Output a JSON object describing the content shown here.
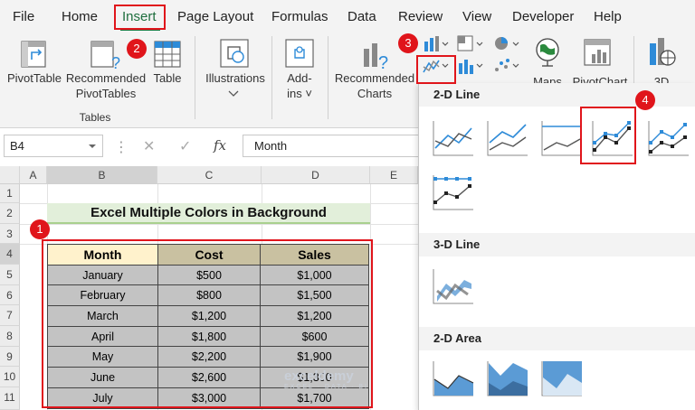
{
  "menu": {
    "items": [
      "File",
      "Home",
      "Insert",
      "Page Layout",
      "Formulas",
      "Data",
      "Review",
      "View",
      "Developer",
      "Help"
    ]
  },
  "ribbon": {
    "pivottable": "PivotTable",
    "recommended_pivottables_1": "Recommended",
    "recommended_pivottables_2": "PivotTables",
    "table": "Table",
    "group_tables": "Tables",
    "illustrations": "Illustrations",
    "addins_1": "Add-",
    "addins_2": "ins",
    "recommended_charts_1": "Recommended",
    "recommended_charts_2": "Charts",
    "maps": "Maps",
    "pivotchart": "PivotChart",
    "threed": "3D"
  },
  "formula_bar": {
    "name_box": "B4",
    "cancel": "✕",
    "enter": "✓",
    "fx": "fx",
    "value": "Month"
  },
  "sheet": {
    "columns": [
      "A",
      "B",
      "C",
      "D",
      "E"
    ],
    "rows": [
      "1",
      "2",
      "3",
      "4",
      "5",
      "6",
      "7",
      "8",
      "9",
      "10",
      "11"
    ],
    "title": "Excel Multiple Colors in Background",
    "table": {
      "headers": [
        "Month",
        "Cost",
        "Sales"
      ],
      "rows": [
        [
          "January",
          "$500",
          "$1,000"
        ],
        [
          "February",
          "$800",
          "$1,500"
        ],
        [
          "March",
          "$1,200",
          "$1,200"
        ],
        [
          "April",
          "$1,800",
          "$600"
        ],
        [
          "May",
          "$2,200",
          "$1,900"
        ],
        [
          "June",
          "$2,600",
          "$1,300"
        ],
        [
          "July",
          "$3,000",
          "$1,700"
        ]
      ]
    }
  },
  "chart_menu": {
    "section_2d_line": "2-D Line",
    "section_3d_line": "3-D Line",
    "section_2d_area": "2-D Area"
  },
  "badges": [
    "1",
    "2",
    "3",
    "4"
  ],
  "watermark": {
    "name": "exceldemy",
    "tagline": "EXCEL · DATA · BI"
  },
  "colors": {
    "accent_red": "#e0151b",
    "line_blue": "#2e8bd8",
    "area_blue": "#5b9bd5"
  }
}
